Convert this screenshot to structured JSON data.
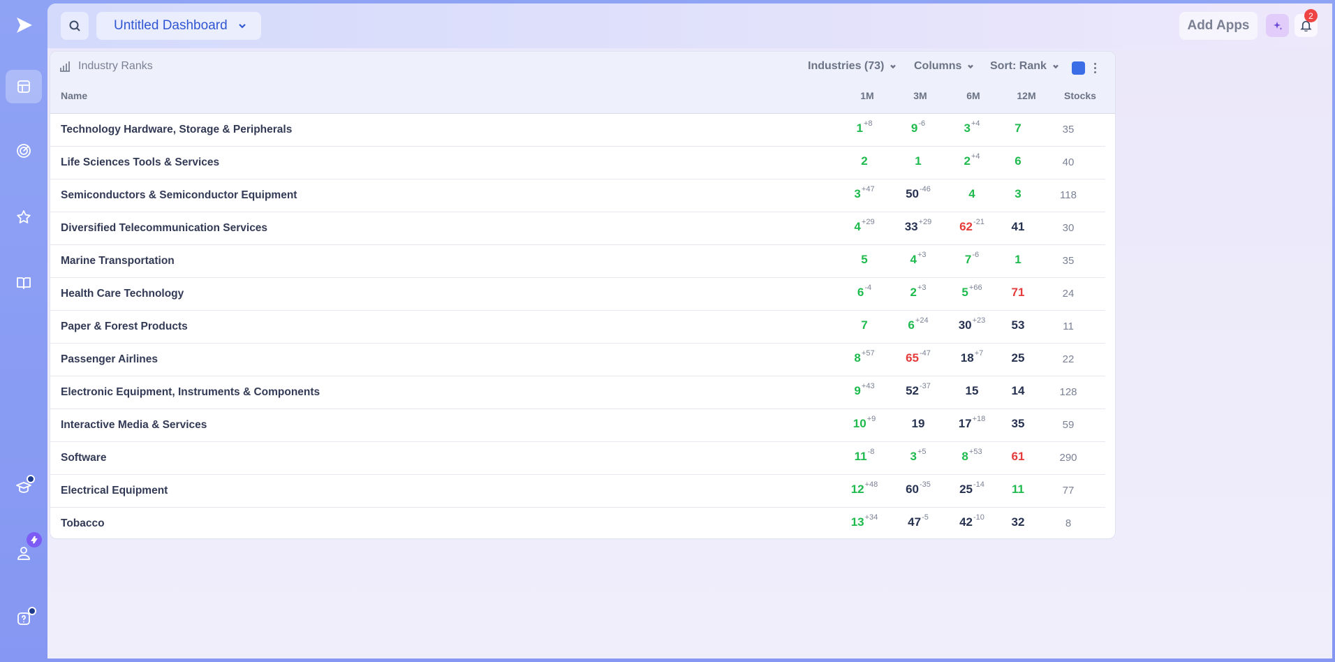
{
  "header": {
    "dashboard_title": "Untitled Dashboard",
    "add_apps_label": "Add Apps",
    "notification_count": "2"
  },
  "sidebar": {
    "items": [
      {
        "icon": "dashboard-icon",
        "active": true
      },
      {
        "icon": "radar-icon",
        "active": false
      },
      {
        "icon": "star-icon",
        "active": false
      },
      {
        "icon": "book-icon",
        "active": false
      },
      {
        "icon": "graduation-cap-icon",
        "active": false
      },
      {
        "icon": "user-icon",
        "active": false
      },
      {
        "icon": "help-icon",
        "active": false
      }
    ]
  },
  "widget": {
    "title": "Industry Ranks",
    "industries_label": "Industries (73)",
    "columns_label": "Columns",
    "sort_label": "Sort: Rank",
    "accent_color": "#3b6ee6",
    "headers": {
      "name": "Name",
      "m1": "1M",
      "m3": "3M",
      "m6": "6M",
      "m12": "12M",
      "stocks": "Stocks"
    },
    "rows": [
      {
        "name": "Technology Hardware, Storage & Peripherals",
        "m1": {
          "v": "1",
          "c": "+8",
          "s": "g"
        },
        "m3": {
          "v": "9",
          "c": "-6",
          "s": "g"
        },
        "m6": {
          "v": "3",
          "c": "+4",
          "s": "g"
        },
        "m12": {
          "v": "7",
          "c": "",
          "s": "g"
        },
        "stocks": "35"
      },
      {
        "name": "Life Sciences Tools & Services",
        "m1": {
          "v": "2",
          "c": "",
          "s": "g"
        },
        "m3": {
          "v": "1",
          "c": "",
          "s": "g"
        },
        "m6": {
          "v": "2",
          "c": "+4",
          "s": "g"
        },
        "m12": {
          "v": "6",
          "c": "",
          "s": "g"
        },
        "stocks": "40"
      },
      {
        "name": "Semiconductors & Semiconductor Equipment",
        "m1": {
          "v": "3",
          "c": "+47",
          "s": "g"
        },
        "m3": {
          "v": "50",
          "c": "-46",
          "s": "d"
        },
        "m6": {
          "v": "4",
          "c": "",
          "s": "g"
        },
        "m12": {
          "v": "3",
          "c": "",
          "s": "g"
        },
        "stocks": "118"
      },
      {
        "name": "Diversified Telecommunication Services",
        "m1": {
          "v": "4",
          "c": "+29",
          "s": "g"
        },
        "m3": {
          "v": "33",
          "c": "+29",
          "s": "d"
        },
        "m6": {
          "v": "62",
          "c": "-21",
          "s": "r"
        },
        "m12": {
          "v": "41",
          "c": "",
          "s": "d"
        },
        "stocks": "30"
      },
      {
        "name": "Marine Transportation",
        "m1": {
          "v": "5",
          "c": "",
          "s": "g"
        },
        "m3": {
          "v": "4",
          "c": "+3",
          "s": "g"
        },
        "m6": {
          "v": "7",
          "c": "-6",
          "s": "g"
        },
        "m12": {
          "v": "1",
          "c": "",
          "s": "g"
        },
        "stocks": "35"
      },
      {
        "name": "Health Care Technology",
        "m1": {
          "v": "6",
          "c": "-4",
          "s": "g"
        },
        "m3": {
          "v": "2",
          "c": "+3",
          "s": "g"
        },
        "m6": {
          "v": "5",
          "c": "+66",
          "s": "g"
        },
        "m12": {
          "v": "71",
          "c": "",
          "s": "r"
        },
        "stocks": "24"
      },
      {
        "name": "Paper & Forest Products",
        "m1": {
          "v": "7",
          "c": "",
          "s": "g"
        },
        "m3": {
          "v": "6",
          "c": "+24",
          "s": "g"
        },
        "m6": {
          "v": "30",
          "c": "+23",
          "s": "d"
        },
        "m12": {
          "v": "53",
          "c": "",
          "s": "d"
        },
        "stocks": "11"
      },
      {
        "name": "Passenger Airlines",
        "m1": {
          "v": "8",
          "c": "+57",
          "s": "g"
        },
        "m3": {
          "v": "65",
          "c": "-47",
          "s": "r"
        },
        "m6": {
          "v": "18",
          "c": "+7",
          "s": "d"
        },
        "m12": {
          "v": "25",
          "c": "",
          "s": "d"
        },
        "stocks": "22"
      },
      {
        "name": "Electronic Equipment, Instruments & Components",
        "m1": {
          "v": "9",
          "c": "+43",
          "s": "g"
        },
        "m3": {
          "v": "52",
          "c": "-37",
          "s": "d"
        },
        "m6": {
          "v": "15",
          "c": "",
          "s": "d"
        },
        "m12": {
          "v": "14",
          "c": "",
          "s": "d"
        },
        "stocks": "128"
      },
      {
        "name": "Interactive Media & Services",
        "m1": {
          "v": "10",
          "c": "+9",
          "s": "g"
        },
        "m3": {
          "v": "19",
          "c": "",
          "s": "d"
        },
        "m6": {
          "v": "17",
          "c": "+18",
          "s": "d"
        },
        "m12": {
          "v": "35",
          "c": "",
          "s": "d"
        },
        "stocks": "59"
      },
      {
        "name": "Software",
        "m1": {
          "v": "11",
          "c": "-8",
          "s": "g"
        },
        "m3": {
          "v": "3",
          "c": "+5",
          "s": "g"
        },
        "m6": {
          "v": "8",
          "c": "+53",
          "s": "g"
        },
        "m12": {
          "v": "61",
          "c": "",
          "s": "r"
        },
        "stocks": "290"
      },
      {
        "name": "Electrical Equipment",
        "m1": {
          "v": "12",
          "c": "+48",
          "s": "g"
        },
        "m3": {
          "v": "60",
          "c": "-35",
          "s": "d"
        },
        "m6": {
          "v": "25",
          "c": "-14",
          "s": "d"
        },
        "m12": {
          "v": "11",
          "c": "",
          "s": "g"
        },
        "stocks": "77"
      },
      {
        "name": "Tobacco",
        "m1": {
          "v": "13",
          "c": "+34",
          "s": "g"
        },
        "m3": {
          "v": "47",
          "c": "-5",
          "s": "d"
        },
        "m6": {
          "v": "42",
          "c": "-10",
          "s": "d"
        },
        "m12": {
          "v": "32",
          "c": "",
          "s": "d"
        },
        "stocks": "8"
      }
    ]
  }
}
